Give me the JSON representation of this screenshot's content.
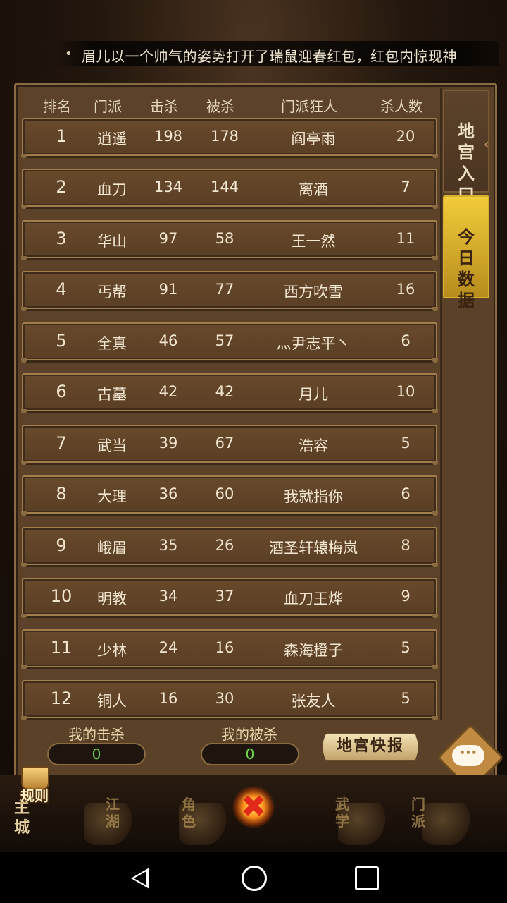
{
  "ticker": {
    "message": "眉儿以一个帅气的姿势打开了瑞鼠迎春红包，红包内惊现神"
  },
  "table": {
    "headers": [
      "排名",
      "门派",
      "击杀",
      "被杀",
      "门派狂人",
      "杀人数"
    ],
    "rows": [
      {
        "rank": "1",
        "sect": "逍遥",
        "kills": "198",
        "deaths": "178",
        "champion": "阎亭雨",
        "champion_kills": "20"
      },
      {
        "rank": "2",
        "sect": "血刀",
        "kills": "134",
        "deaths": "144",
        "champion": "离酒",
        "champion_kills": "7"
      },
      {
        "rank": "3",
        "sect": "华山",
        "kills": "97",
        "deaths": "58",
        "champion": "王一然",
        "champion_kills": "11"
      },
      {
        "rank": "4",
        "sect": "丐帮",
        "kills": "91",
        "deaths": "77",
        "champion": "西方吹雪",
        "champion_kills": "16"
      },
      {
        "rank": "5",
        "sect": "全真",
        "kills": "46",
        "deaths": "57",
        "champion": "灬尹志平丶",
        "champion_kills": "6"
      },
      {
        "rank": "6",
        "sect": "古墓",
        "kills": "42",
        "deaths": "42",
        "champion": "月儿",
        "champion_kills": "10"
      },
      {
        "rank": "7",
        "sect": "武当",
        "kills": "39",
        "deaths": "67",
        "champion": "浩容",
        "champion_kills": "5"
      },
      {
        "rank": "8",
        "sect": "大理",
        "kills": "36",
        "deaths": "60",
        "champion": "我就指你",
        "champion_kills": "6"
      },
      {
        "rank": "9",
        "sect": "峨眉",
        "kills": "35",
        "deaths": "26",
        "champion": "酒圣轩辕梅岚",
        "champion_kills": "8"
      },
      {
        "rank": "10",
        "sect": "明教",
        "kills": "34",
        "deaths": "37",
        "champion": "血刀王烨",
        "champion_kills": "9"
      },
      {
        "rank": "11",
        "sect": "少林",
        "kills": "24",
        "deaths": "16",
        "champion": "森海橙子",
        "champion_kills": "5"
      },
      {
        "rank": "12",
        "sect": "铜人",
        "kills": "16",
        "deaths": "30",
        "champion": "张友人",
        "champion_kills": "5"
      }
    ]
  },
  "footer": {
    "my_kills_label": "我的击杀",
    "my_kills_value": "0",
    "my_deaths_label": "我的被杀",
    "my_deaths_value": "0",
    "news_button": "地宫快报"
  },
  "side_tabs": {
    "entrance": "地\n宫\n入\n口",
    "today": "今\n日\n数\n据"
  },
  "bottom_nav": {
    "rules": "规则",
    "main_city": "主城",
    "items": [
      "江湖",
      "角色",
      "武学",
      "门派"
    ]
  },
  "colors": {
    "panel": "#5a4128",
    "active_tab": "#f2cc3a",
    "stat_value": "#6fd24a"
  }
}
